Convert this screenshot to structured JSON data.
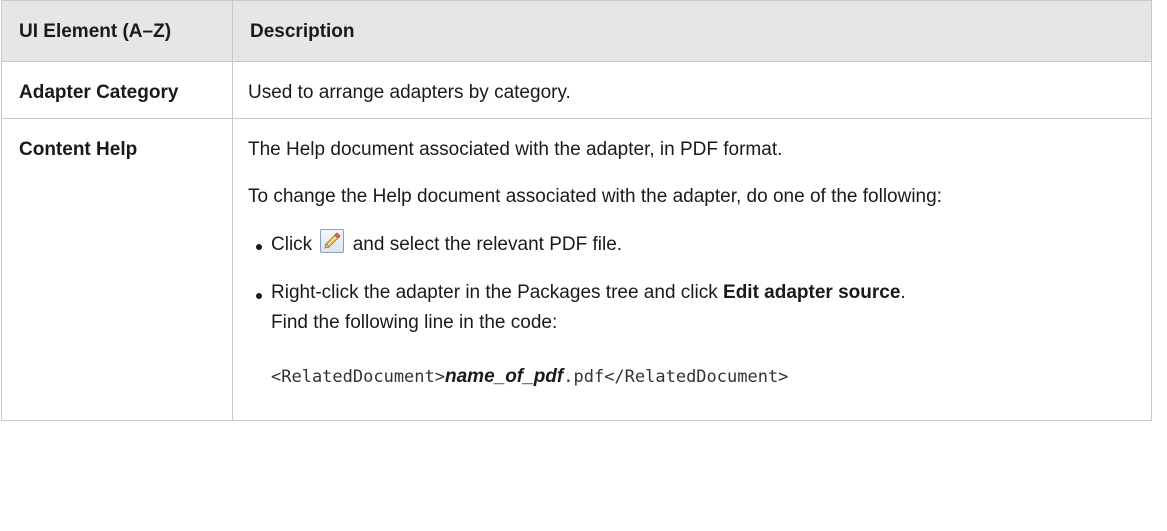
{
  "table": {
    "headers": {
      "element": "UI Element (A–Z)",
      "description": "Description"
    },
    "rows": [
      {
        "element": "Adapter Category",
        "description": "Used to arrange adapters by category."
      },
      {
        "element": "Content Help",
        "description_intro": "The Help document associated with the adapter, in PDF format.",
        "description_change": "To change the Help document associated with the adapter, do one of the following:",
        "option_1": {
          "before_icon": "Click",
          "icon": "pencil-edit-icon",
          "after_icon": "and select the relevant PDF file."
        },
        "option_2": {
          "before_bold": "Right-click the adapter in the Packages tree and click",
          "bold": "Edit adapter source",
          "after_bold": ".",
          "second_line": "Find the following line in the code:"
        },
        "code": {
          "open_tag": "<RelatedDocument>",
          "placeholder": "name_of_pdf",
          "close_part": ".pdf</RelatedDocument>"
        }
      }
    ]
  }
}
